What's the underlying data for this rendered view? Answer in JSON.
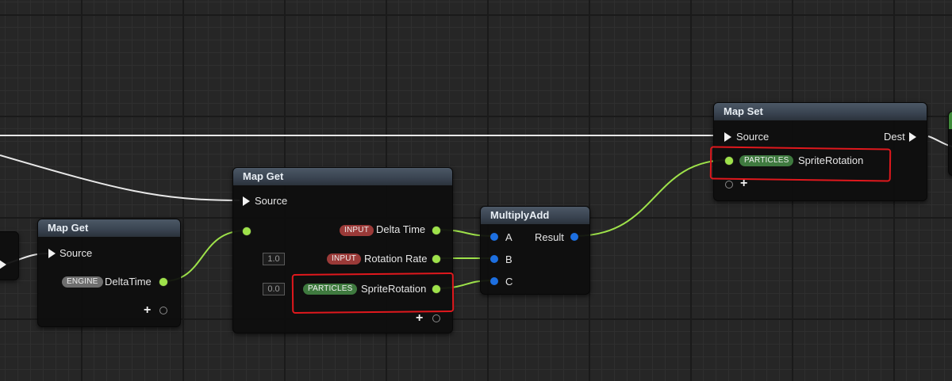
{
  "nodes": {
    "map_get_engine": {
      "title": "Map Get",
      "source_label": "Source",
      "output": {
        "namespace": "ENGINE",
        "name": "DeltaTime"
      }
    },
    "map_get_main": {
      "title": "Map Get",
      "source_label": "Source",
      "outputs": [
        {
          "namespace": "INPUT",
          "name": "Delta Time"
        },
        {
          "namespace": "INPUT",
          "name": "Rotation Rate",
          "default_value": "1.0"
        },
        {
          "namespace": "PARTICLES",
          "name": "SpriteRotation",
          "default_value": "0.0"
        }
      ]
    },
    "multiply_add": {
      "title": "MultiplyAdd",
      "inputs": [
        "A",
        "B",
        "C"
      ],
      "result_label": "Result"
    },
    "map_set": {
      "title": "Map Set",
      "source_label": "Source",
      "dest_label": "Dest",
      "input": {
        "namespace": "PARTICLES",
        "name": "SpriteRotation"
      }
    }
  },
  "colors": {
    "float_pin": "#9ee24a",
    "vector_pin": "#1d6fe0",
    "exec_wire": "#e8e8e8",
    "highlight": "#e0181d",
    "badge_input": "#9a3a38",
    "badge_engine": "#6e6e6e",
    "badge_particles": "#3f7a3f"
  },
  "icons": {
    "add_pin": "plus-icon",
    "exec": "exec-arrow-icon",
    "float_pin": "green-dot",
    "vector_pin": "blue-dot"
  }
}
